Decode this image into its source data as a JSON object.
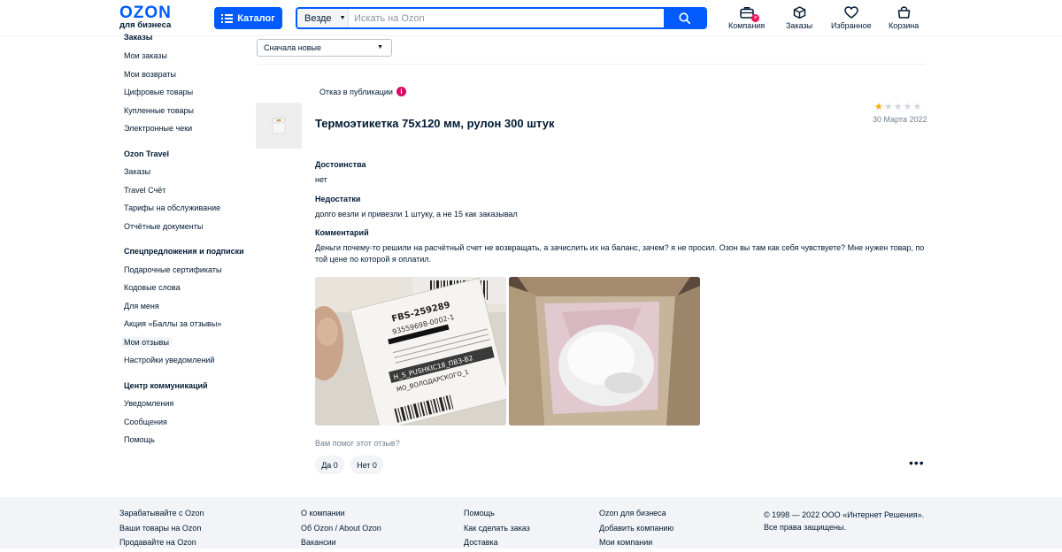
{
  "header": {
    "logo_text": "OZON",
    "logo_subtext": "для бизнеса",
    "catalog_label": "Каталог",
    "search_scope": "Везде",
    "search_placeholder": "Искать на Ozon",
    "nav": [
      {
        "label": "Компания",
        "icon": "briefcase-icon"
      },
      {
        "label": "Заказы",
        "icon": "box-icon"
      },
      {
        "label": "Избранное",
        "icon": "heart-icon"
      },
      {
        "label": "Корзина",
        "icon": "bag-icon"
      }
    ],
    "accent_color": "#005bff"
  },
  "sidebar": {
    "sections": [
      {
        "heading": "Заказы",
        "items": [
          "Мои заказы",
          "Мои возвраты",
          "Цифровые товары",
          "Купленные товары",
          "Электронные чеки"
        ]
      },
      {
        "heading": "Ozon Travel",
        "items": [
          "Заказы",
          "Travel Счёт",
          "Тарифы на обслуживание",
          "Отчётные документы"
        ]
      },
      {
        "heading": "Спецпредложения и подписки",
        "items": [
          "Подарочные сертификаты",
          "Кодовые слова",
          "Для меня",
          "Акция «Баллы за отзывы»",
          "Мои отзывы",
          "Настройки уведомлений"
        ]
      },
      {
        "heading": "Центр коммуникаций",
        "items": [
          "Уведомления",
          "Сообщения",
          "Помощь"
        ]
      }
    ],
    "active_item": "Мои отзывы"
  },
  "main": {
    "sort_value": "Сначала новые",
    "review": {
      "status": "Отказ в публикации",
      "product_title": "Термоэтикетка 75х120 мм, рулон 300 штук",
      "rating": 1,
      "rating_max": 5,
      "date": "30 Марта 2022",
      "pros_label": "Достоинства",
      "pros_text": "нет",
      "cons_label": "Недостатки",
      "cons_text": "долго везли и привезли 1 штуку, а не 15 как заказывал",
      "comment_label": "Комментарий",
      "comment_text": "Деньги почему-то решили на расчётный счет не возвращать, а зачислить их на баланс, зачем? я не просил. Озон вы там как себя чувствуете? Мне нужен товар, по той цене по которой я оплатил.",
      "photo_label_text": [
        "FBS-259289",
        "93559698-0002-1",
        "H_S_PUSHKIC18_ПВЗ-B2",
        "MO_ВОЛОДАРСКОГО_1"
      ],
      "helpful_question": "Вам помог этот отзыв?",
      "yes_label": "Да 0",
      "no_label": "Нет 0",
      "more_label": "•••"
    }
  },
  "footer": {
    "columns": [
      {
        "heading": "Зарабатывайте с Ozon",
        "links": [
          "Ваши товары на Ozon",
          "Продавайте на Ozon"
        ]
      },
      {
        "heading": "О компании",
        "links": [
          "Об Ozon / About Ozon",
          "Вакансии"
        ]
      },
      {
        "heading": "Помощь",
        "links": [
          "Как сделать заказ",
          "Доставка"
        ]
      },
      {
        "heading": "Ozon для бизнеса",
        "links": [
          "Добавить компанию",
          "Мои компании"
        ]
      }
    ],
    "copyright_line1": "© 1998 — 2022 ООО «Интернет Решения».",
    "copyright_line2": "Все права защищены."
  }
}
